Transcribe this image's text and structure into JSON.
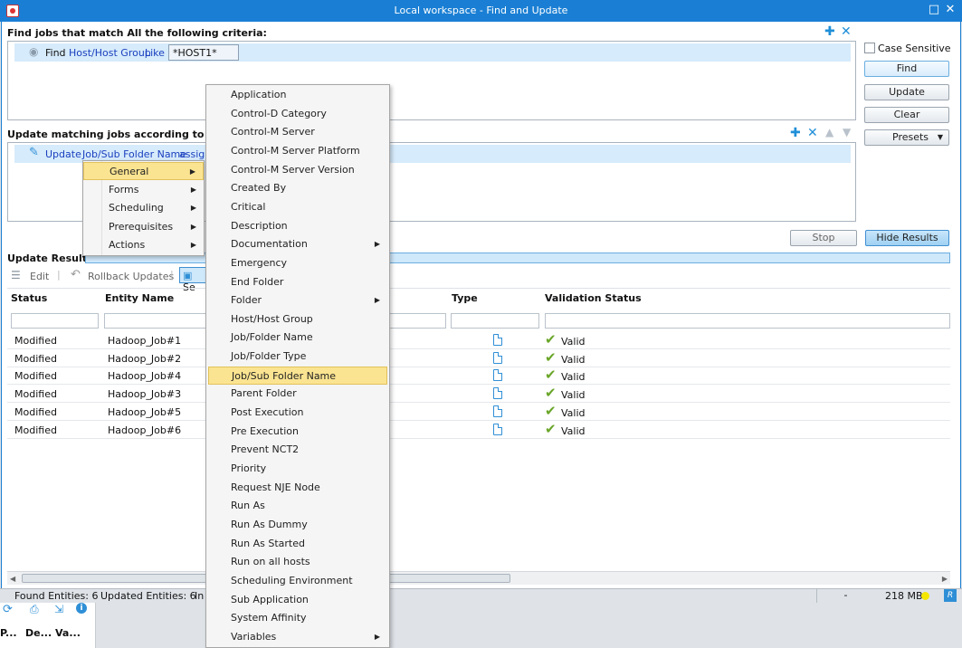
{
  "window": {
    "title": "Local workspace - Find and Update"
  },
  "find_section": {
    "title": "Find jobs that match All the following criteria:",
    "row": {
      "verb": "Find",
      "field": "Host/Host Group",
      "operator": "Like",
      "value": "*HOST1*"
    }
  },
  "side_buttons": {
    "case_sensitive": "Case Sensitive",
    "find": "Find",
    "update": "Update",
    "clear": "Clear",
    "presets": "Presets"
  },
  "update_section": {
    "title": "Update matching jobs according to follov",
    "row": {
      "verb": "Update",
      "field": "Job/Sub Folder Name",
      "op": "assign"
    }
  },
  "action_buttons": {
    "stop": "Stop",
    "hide_results": "Hide Results"
  },
  "results": {
    "title": "Update Results",
    "toolbar": {
      "edit": "Edit",
      "rollback": "Rollback Updates",
      "select": "Se"
    },
    "columns": {
      "status": "Status",
      "entity_name": "Entity Name",
      "type": "Type",
      "validation": "Validation Status"
    },
    "rows": [
      {
        "status": "Modified",
        "entity": "Hadoop_Job#1",
        "validation": "Valid"
      },
      {
        "status": "Modified",
        "entity": "Hadoop_Job#2",
        "validation": "Valid"
      },
      {
        "status": "Modified",
        "entity": "Hadoop_Job#4",
        "validation": "Valid"
      },
      {
        "status": "Modified",
        "entity": "Hadoop_Job#3",
        "validation": "Valid"
      },
      {
        "status": "Modified",
        "entity": "Hadoop_Job#5",
        "validation": "Valid"
      },
      {
        "status": "Modified",
        "entity": "Hadoop_Job#6",
        "validation": "Valid"
      }
    ]
  },
  "statusbar": {
    "found": "Found Entities: 6",
    "updated": "Updated Entities: 6",
    "truncated": "In",
    "dash": "-",
    "memory": "218 MB"
  },
  "bottom_panel": {
    "col1": "P...",
    "col2": "De...",
    "col3": "Va..."
  },
  "category_menu": [
    {
      "label": "General",
      "submenu": true,
      "highlighted": true
    },
    {
      "label": "Forms",
      "submenu": true
    },
    {
      "label": "Scheduling",
      "submenu": true
    },
    {
      "label": "Prerequisites",
      "submenu": true
    },
    {
      "label": "Actions",
      "submenu": true
    }
  ],
  "field_menu": [
    {
      "label": "Application"
    },
    {
      "label": "Control-D Category"
    },
    {
      "label": "Control-M Server"
    },
    {
      "label": "Control-M Server Platform"
    },
    {
      "label": "Control-M Server Version"
    },
    {
      "label": "Created By"
    },
    {
      "label": "Critical"
    },
    {
      "label": "Description"
    },
    {
      "label": "Documentation",
      "submenu": true
    },
    {
      "label": "Emergency"
    },
    {
      "label": "End Folder"
    },
    {
      "label": "Folder",
      "submenu": true
    },
    {
      "label": "Host/Host Group"
    },
    {
      "label": "Job/Folder Name"
    },
    {
      "label": "Job/Folder Type"
    },
    {
      "label": "Job/Sub Folder Name",
      "highlighted": true
    },
    {
      "label": "Parent Folder"
    },
    {
      "label": "Post Execution"
    },
    {
      "label": "Pre Execution"
    },
    {
      "label": "Prevent NCT2"
    },
    {
      "label": "Priority"
    },
    {
      "label": "Request NJE Node"
    },
    {
      "label": "Run As"
    },
    {
      "label": "Run As Dummy"
    },
    {
      "label": "Run As Started"
    },
    {
      "label": "Run on all hosts"
    },
    {
      "label": "Scheduling Environment"
    },
    {
      "label": "Sub Application"
    },
    {
      "label": "System Affinity"
    },
    {
      "label": "Variables",
      "submenu": true
    }
  ]
}
